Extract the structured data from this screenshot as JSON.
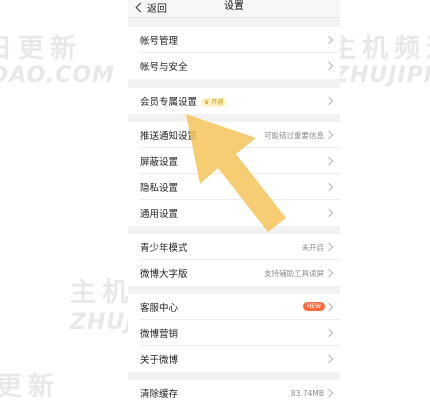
{
  "navbar": {
    "back_label": "返回",
    "title": "设置"
  },
  "rows": {
    "account_manage": {
      "label": "帐号管理"
    },
    "account_security": {
      "label": "帐号与安全"
    },
    "vip_settings": {
      "label": "会员专属设置",
      "badge": "♛ 开通"
    },
    "push": {
      "label": "推送通知设置",
      "value": "可能错过重要信息"
    },
    "block": {
      "label": "屏蔽设置"
    },
    "privacy": {
      "label": "隐私设置"
    },
    "general": {
      "label": "通用设置"
    },
    "teen": {
      "label": "青少年模式",
      "value": "未开启"
    },
    "large_font": {
      "label": "微博大字版",
      "value": "支持辅助工具读屏"
    },
    "support": {
      "label": "客服中心",
      "badge": "NEW"
    },
    "marketing": {
      "label": "微博营销"
    },
    "about": {
      "label": "关于微博"
    },
    "cache": {
      "label": "清除缓存",
      "value": "83.74MB"
    }
  },
  "watermark": {
    "cn": "主机频道 每日更新",
    "en": "ZHUJIPINDAO.COM"
  },
  "colors": {
    "arrow": "#f5c45a",
    "new_badge": "#ff6a3d",
    "background": "#f2f2f2"
  }
}
